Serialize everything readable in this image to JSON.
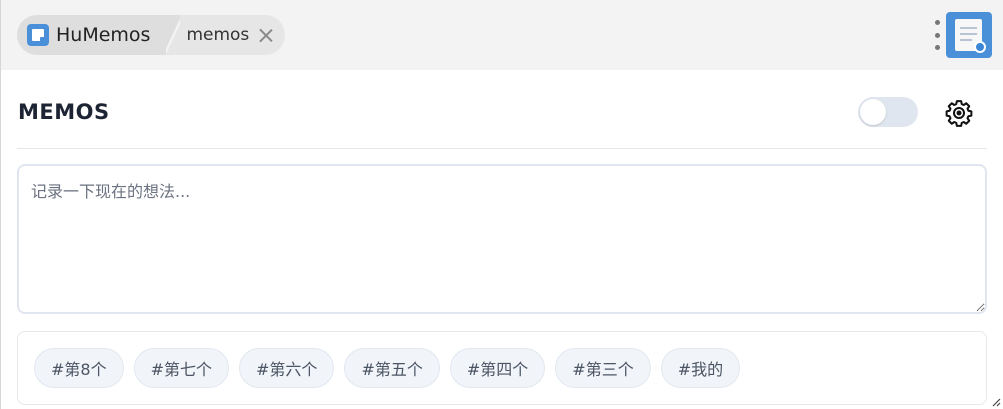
{
  "header": {
    "app_name": "HuMemos",
    "tab_label": "memos"
  },
  "main": {
    "title": "MEMOS",
    "editor_placeholder": "记录一下现在的想法...",
    "tags": [
      "#第8个",
      "#第七个",
      "#第六个",
      "#第五个",
      "#第四个",
      "#第三个",
      "#我的"
    ]
  },
  "colors": {
    "accent": "#4a90d9",
    "header_bg": "#f3f3f3",
    "toggle_off": "#e0e6ef",
    "tag_bg": "#f1f4f9"
  },
  "icons": {
    "app": "memo-note-icon",
    "close": "close-icon",
    "more": "more-vertical-icon",
    "plugin": "note-app-icon",
    "settings": "gear-icon"
  },
  "state": {
    "toggle_on": false
  }
}
